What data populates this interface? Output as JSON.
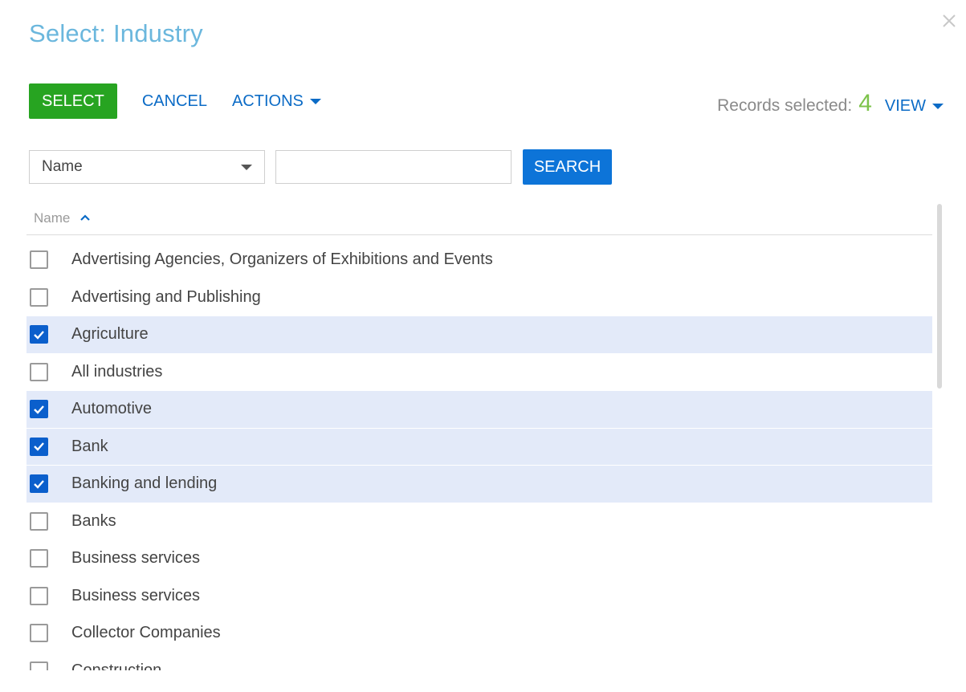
{
  "dialog": {
    "title": "Select: Industry"
  },
  "toolbar": {
    "select_label": "SELECT",
    "cancel_label": "CANCEL",
    "actions_label": "ACTIONS",
    "records_label": "Records selected:",
    "records_count": "4",
    "view_label": "VIEW"
  },
  "filter": {
    "column_value": "Name",
    "search_value": "",
    "search_label": "SEARCH"
  },
  "table": {
    "column_header": "Name",
    "sort": "ascending",
    "rows": [
      {
        "label": "Advertising Agencies, Organizers of Exhibitions and Events",
        "checked": false
      },
      {
        "label": "Advertising and Publishing",
        "checked": false
      },
      {
        "label": "Agriculture",
        "checked": true
      },
      {
        "label": "All industries",
        "checked": false
      },
      {
        "label": "Automotive",
        "checked": true
      },
      {
        "label": "Bank",
        "checked": true
      },
      {
        "label": "Banking and lending",
        "checked": true
      },
      {
        "label": "Banks",
        "checked": false
      },
      {
        "label": "Business services",
        "checked": false
      },
      {
        "label": "Business services",
        "checked": false
      },
      {
        "label": "Collector Companies",
        "checked": false
      },
      {
        "label": "Construction",
        "checked": false
      }
    ]
  },
  "colors": {
    "title": "#6bb7dd",
    "select_button": "#27a421",
    "search_button": "#0d74d8",
    "link": "#0b6bc6",
    "count": "#7dc34b",
    "selected_row": "#e3eaf9"
  },
  "icons": {
    "close": "close-icon",
    "sort": "chevron-up-icon",
    "checkbox": "checkmark-icon"
  }
}
